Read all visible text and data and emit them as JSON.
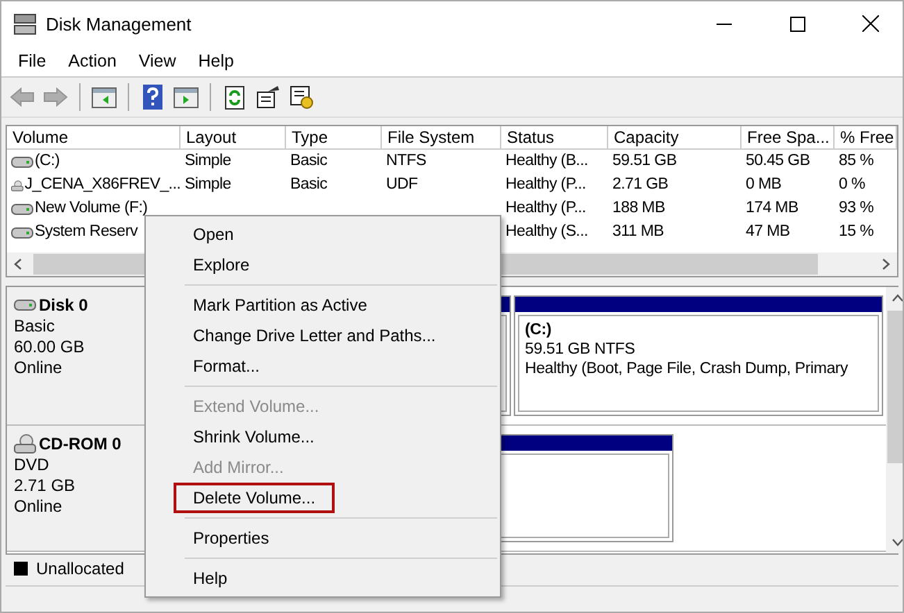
{
  "window": {
    "title": "Disk Management"
  },
  "menu_bar": [
    "File",
    "Action",
    "View",
    "Help"
  ],
  "toolbar": [
    {
      "kind": "back",
      "disabled": true
    },
    {
      "kind": "forward",
      "disabled": true
    },
    {
      "kind": "pane-left",
      "disabled": false
    },
    {
      "kind": "help",
      "disabled": false
    },
    {
      "kind": "pane-right",
      "disabled": false
    },
    {
      "kind": "refresh",
      "disabled": false
    },
    {
      "kind": "properties",
      "disabled": false
    },
    {
      "kind": "settings",
      "disabled": false
    }
  ],
  "volume_table": {
    "columns": [
      "Volume",
      "Layout",
      "Type",
      "File System",
      "Status",
      "Capacity",
      "Free Spa...",
      "% Free"
    ],
    "rows": [
      {
        "kind": "disk",
        "cells": [
          "(C:)",
          "Simple",
          "Basic",
          "NTFS",
          "Healthy (B...",
          "59.51 GB",
          "50.45 GB",
          "85 %"
        ]
      },
      {
        "kind": "cd",
        "cells": [
          "J_CENA_X86FREV_...",
          "Simple",
          "Basic",
          "UDF",
          "Healthy (P...",
          "2.71 GB",
          "0 MB",
          "0 %"
        ]
      },
      {
        "kind": "disk",
        "cells": [
          "New Volume (F:)",
          null,
          null,
          null,
          "Healthy (P...",
          "188 MB",
          "174 MB",
          "93 %"
        ]
      },
      {
        "kind": "disk",
        "cells": [
          "System Reserv",
          null,
          null,
          null,
          "Healthy (S...",
          "311 MB",
          "47 MB",
          "15 %"
        ]
      }
    ]
  },
  "disks": [
    {
      "kind": "disk",
      "name": "Disk 0",
      "type": "Basic",
      "size": "60.00 GB",
      "state": "Online",
      "partitions": [
        {
          "kind": "covered"
        },
        {
          "kind": "volume",
          "label": "(C:)",
          "detail": "59.51 GB NTFS",
          "status": "Healthy (Boot, Page File, Crash Dump, Primary"
        }
      ]
    },
    {
      "kind": "cd",
      "name": "CD-ROM 0",
      "type": "DVD",
      "size": "2.71 GB",
      "state": "Online",
      "partitions": [
        {
          "kind": "covered"
        }
      ]
    }
  ],
  "legend": [
    {
      "label": "Unallocated",
      "color": "#000000"
    }
  ],
  "context_menu": [
    {
      "kind": "item",
      "label": "Open",
      "disabled": false,
      "highlighted": false
    },
    {
      "kind": "item",
      "label": "Explore",
      "disabled": false,
      "highlighted": false
    },
    {
      "kind": "separator"
    },
    {
      "kind": "item",
      "label": "Mark Partition as Active",
      "disabled": false,
      "highlighted": false
    },
    {
      "kind": "item",
      "label": "Change Drive Letter and Paths...",
      "disabled": false,
      "highlighted": false
    },
    {
      "kind": "item",
      "label": "Format...",
      "disabled": false,
      "highlighted": false
    },
    {
      "kind": "separator"
    },
    {
      "kind": "item",
      "label": "Extend Volume...",
      "disabled": true,
      "highlighted": false
    },
    {
      "kind": "item",
      "label": "Shrink Volume...",
      "disabled": false,
      "highlighted": false
    },
    {
      "kind": "item",
      "label": "Add Mirror...",
      "disabled": true,
      "highlighted": false
    },
    {
      "kind": "item",
      "label": "Delete Volume...",
      "disabled": false,
      "highlighted": true
    },
    {
      "kind": "separator"
    },
    {
      "kind": "item",
      "label": "Properties",
      "disabled": false,
      "highlighted": false
    },
    {
      "kind": "separator"
    },
    {
      "kind": "item",
      "label": "Help",
      "disabled": false,
      "highlighted": false
    }
  ]
}
